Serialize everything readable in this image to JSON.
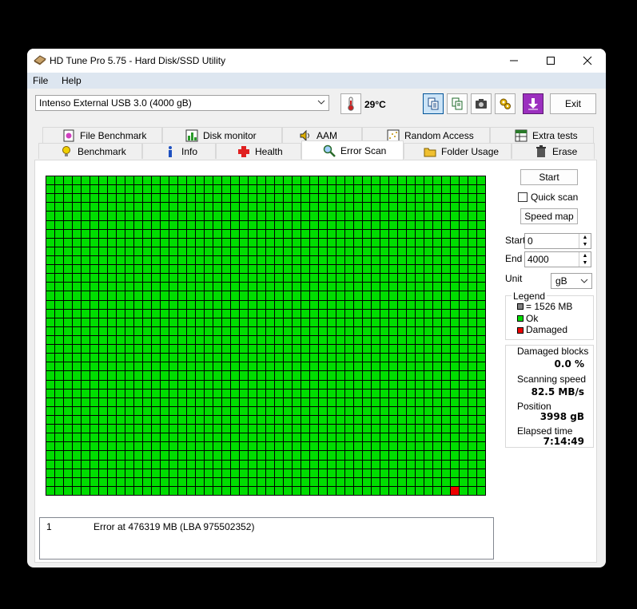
{
  "window": {
    "title": "HD Tune Pro 5.75 - Hard Disk/SSD Utility",
    "controls": {
      "minimize": "—",
      "maximize": "☐",
      "close": "✕"
    }
  },
  "menu": [
    {
      "label": "File"
    },
    {
      "label": "Help"
    }
  ],
  "toolbar": {
    "drive": "Intenso External USB 3.0 (4000 gB)",
    "temperature": "29°C",
    "exit_label": "Exit"
  },
  "tabs": {
    "row1": [
      "File Benchmark",
      "Disk monitor",
      "AAM",
      "Random Access",
      "Extra tests"
    ],
    "row2": [
      "Benchmark",
      "Info",
      "Health",
      "Error Scan",
      "Folder Usage",
      "Erase"
    ],
    "active": "Error Scan"
  },
  "scan": {
    "columns": 50,
    "rows": 36,
    "damaged_blocks": [
      [
        35,
        46
      ]
    ],
    "colors": {
      "ok": "#00dd00",
      "damaged": "#ee0000",
      "size": "#808080"
    }
  },
  "controls": {
    "start_button": "Start",
    "quick_scan_label": "Quick scan",
    "quick_scan_checked": false,
    "speed_map_button": "Speed map",
    "start_label": "Start",
    "start_value": "0",
    "end_label": "End",
    "end_value": "4000",
    "unit_label": "Unit",
    "unit_value": "gB"
  },
  "legend": {
    "title": "Legend",
    "size": "= 1526 MB",
    "ok": "Ok",
    "damaged": "Damaged"
  },
  "stats": {
    "damaged_blocks_label": "Damaged blocks",
    "damaged_blocks_value": "0.0 %",
    "scanning_speed_label": "Scanning speed",
    "scanning_speed_value": "82.5 MB/s",
    "position_label": "Position",
    "position_value": "3998 gB",
    "elapsed_label": "Elapsed time",
    "elapsed_value": "7:14:49"
  },
  "errors": [
    {
      "index": "1",
      "text": "Error at 476319 MB (LBA 975502352)"
    }
  ]
}
